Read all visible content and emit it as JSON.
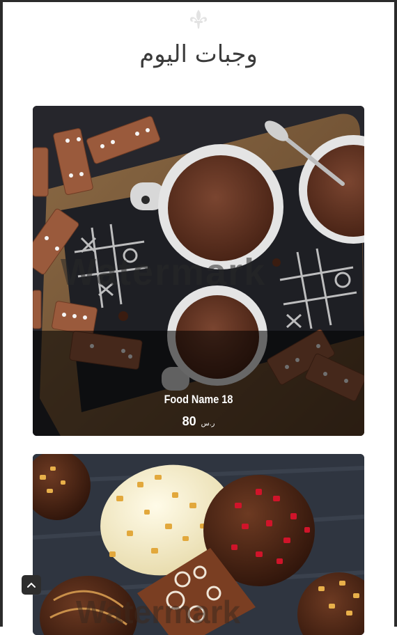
{
  "header": {
    "logo_icon": "fleur-de-lis-icon",
    "title": "وجبات اليوم"
  },
  "cards": [
    {
      "name": "Food Name 18",
      "price": "80",
      "currency": "ر.س",
      "image": "chocolate-cups-dominoes-photo",
      "watermark": "Watermark"
    },
    {
      "image": "chocolate-truffles-photo",
      "watermark": "Watermark"
    }
  ],
  "controls": {
    "scroll_top_icon": "chevron-up-icon"
  }
}
